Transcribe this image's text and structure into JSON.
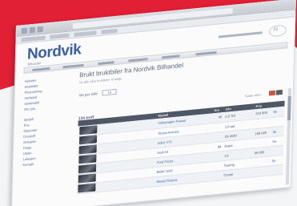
{
  "brand": {
    "logo_text": "Nordvik",
    "logo_sub": "Bilhandel",
    "badge_text": "N"
  },
  "sidebar": {
    "links": [
      "Nyheter",
      "Bruktbiler",
      "Finansiering",
      "Verksted",
      "Dekkhotell",
      "Om oss",
      "",
      "Modell",
      "Pris",
      "Kilometer",
      "Drivstoff",
      "Girkasse",
      "Farge",
      "Utstyr",
      "Lokasjon",
      "Kontakt"
    ]
  },
  "main": {
    "title": "Brukt bruktbiler fra Nordvik Bilhandel",
    "subtitle": "Se alle våre bruktbiler til salgs",
    "filter_label": "Vis per side",
    "filter_value": "10",
    "results_count": "134 treff",
    "sort_label": "Sorter etter"
  },
  "table": {
    "headers": [
      "",
      "Modell",
      "Km",
      "Info",
      "Pris",
      ""
    ],
    "rows": [
      {
        "model": "Volkswagen Passat",
        "km": "45",
        "info": "2.0 TDI",
        "price": "219 900",
        "action": "Se"
      },
      {
        "model": "Toyota Avensis",
        "km": "",
        "info": "1.8 aut",
        "price": "",
        "action": ""
      },
      {
        "model": "Volvo V70",
        "km": "",
        "info": "D5 AWD",
        "price": "189 000",
        "action": "Se"
      },
      {
        "model": "Audi A4",
        "km": "88",
        "info": "Avant",
        "price": "",
        "action": "Se"
      },
      {
        "model": "Ford Focus",
        "km": "",
        "info": "1.6",
        "price": "99 000",
        "action": ""
      },
      {
        "model": "BMW 320d",
        "km": "",
        "info": "Touring",
        "price": "",
        "action": "Se"
      },
      {
        "model": "Skoda Octavia",
        "km": "",
        "info": "Combi",
        "price": "",
        "action": ""
      }
    ]
  },
  "colors": {
    "accent_red": "#e11f35",
    "link_blue": "#3f66a8",
    "table_head": "#4e5765"
  }
}
